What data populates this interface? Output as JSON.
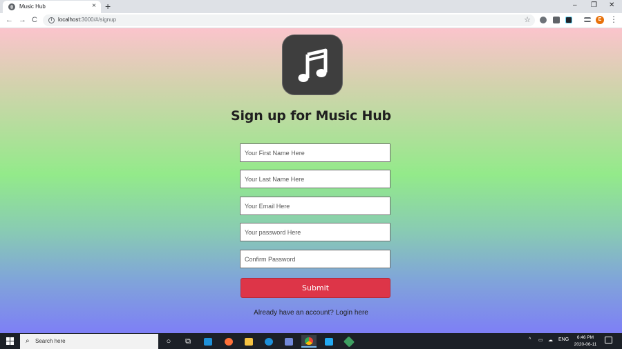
{
  "browser": {
    "tab_title": "Music Hub",
    "tab_close": "×",
    "new_tab": "+",
    "url_host": "localhost",
    "url_path": ":3000/#/signup",
    "window_minimize": "–",
    "window_restore": "❐",
    "window_close": "✕",
    "back": "←",
    "forward": "→",
    "reload": "C",
    "star": "☆",
    "menu": "⋮",
    "profile_initial": "E"
  },
  "page": {
    "heading": "Sign up for Music Hub",
    "fields": {
      "first_name_placeholder": "Your First Name Here",
      "last_name_placeholder": "Your Last Name Here",
      "email_placeholder": "Your Email Here",
      "password_placeholder": "Your password Here",
      "confirm_placeholder": "Confirm Password"
    },
    "submit_label": "Submit",
    "already_text": "Already have an account? ",
    "login_link": "Login here",
    "colors": {
      "submit": "#dd3548",
      "logo_bg": "#3e3e3e"
    },
    "logo_icon": "music-note-icon"
  },
  "taskbar": {
    "search_placeholder": "Search here",
    "language": "ENG",
    "time": "6:46 PM",
    "date": "2020-06-11"
  }
}
